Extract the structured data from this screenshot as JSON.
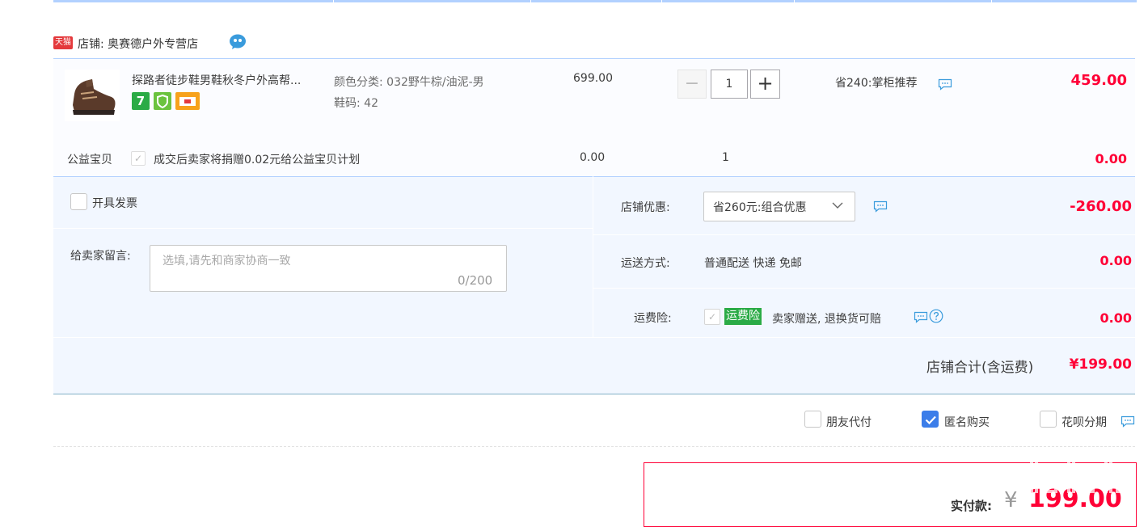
{
  "shop": {
    "logo_text": "天猫",
    "name": "店铺: 奥赛德户外专营店"
  },
  "item": {
    "title": "探路者徒步鞋男鞋秋冬户外高帮...",
    "badge_7": "7",
    "sku_color": "颜色分类: 032野牛棕/油泥-男",
    "sku_size": "鞋码: 42",
    "price": "699.00",
    "qty_minus": "−",
    "qty": "1",
    "qty_plus": "+",
    "promo": "省240:掌柜推荐",
    "total": "459.00"
  },
  "charity": {
    "label": "公益宝贝",
    "check": "✓",
    "text": "成交后卖家将捐赠0.02元给公益宝贝计划",
    "price": "0.00",
    "qty": "1",
    "total": "0.00"
  },
  "order": {
    "invoice_label": "开具发票",
    "message_label": "给卖家留言:",
    "message_placeholder": "选填,请先和商家协商一致",
    "message_count": "0/200",
    "discount_label": "店铺优惠:",
    "discount_selected": "省260元:组合优惠",
    "discount_value": "-260.00",
    "shipping_label": "运送方式:",
    "shipping_value": "普通配送 快递 免邮",
    "shipping_cost": "0.00",
    "insurance_label": "运费险:",
    "insurance_check": "✓",
    "insurance_tag": "运费险",
    "insurance_text": "卖家赠送, 退换货可赔",
    "insurance_cost": "0.00",
    "shop_total_label": "店铺合计(含运费)",
    "shop_total_value": "¥199.00"
  },
  "options": {
    "friend_pay": "朋友代付",
    "anonymous": "匿名购买",
    "huabei": "花呗分期"
  },
  "payment": {
    "label": "实付款:",
    "currency": "¥",
    "value": "199.00"
  },
  "colors": {
    "accent_red": "#ff0036",
    "panel_blue": "#f2f7ff",
    "border_blue": "#b2d1ff",
    "checkbox_blue": "#3b7de9",
    "insurance_green": "#2bab46"
  },
  "icons": [
    "tmall-logo",
    "chat-bubble-icon",
    "message-icon",
    "chevron-down-icon",
    "help-icon",
    "checkbox-checked-icon"
  ]
}
